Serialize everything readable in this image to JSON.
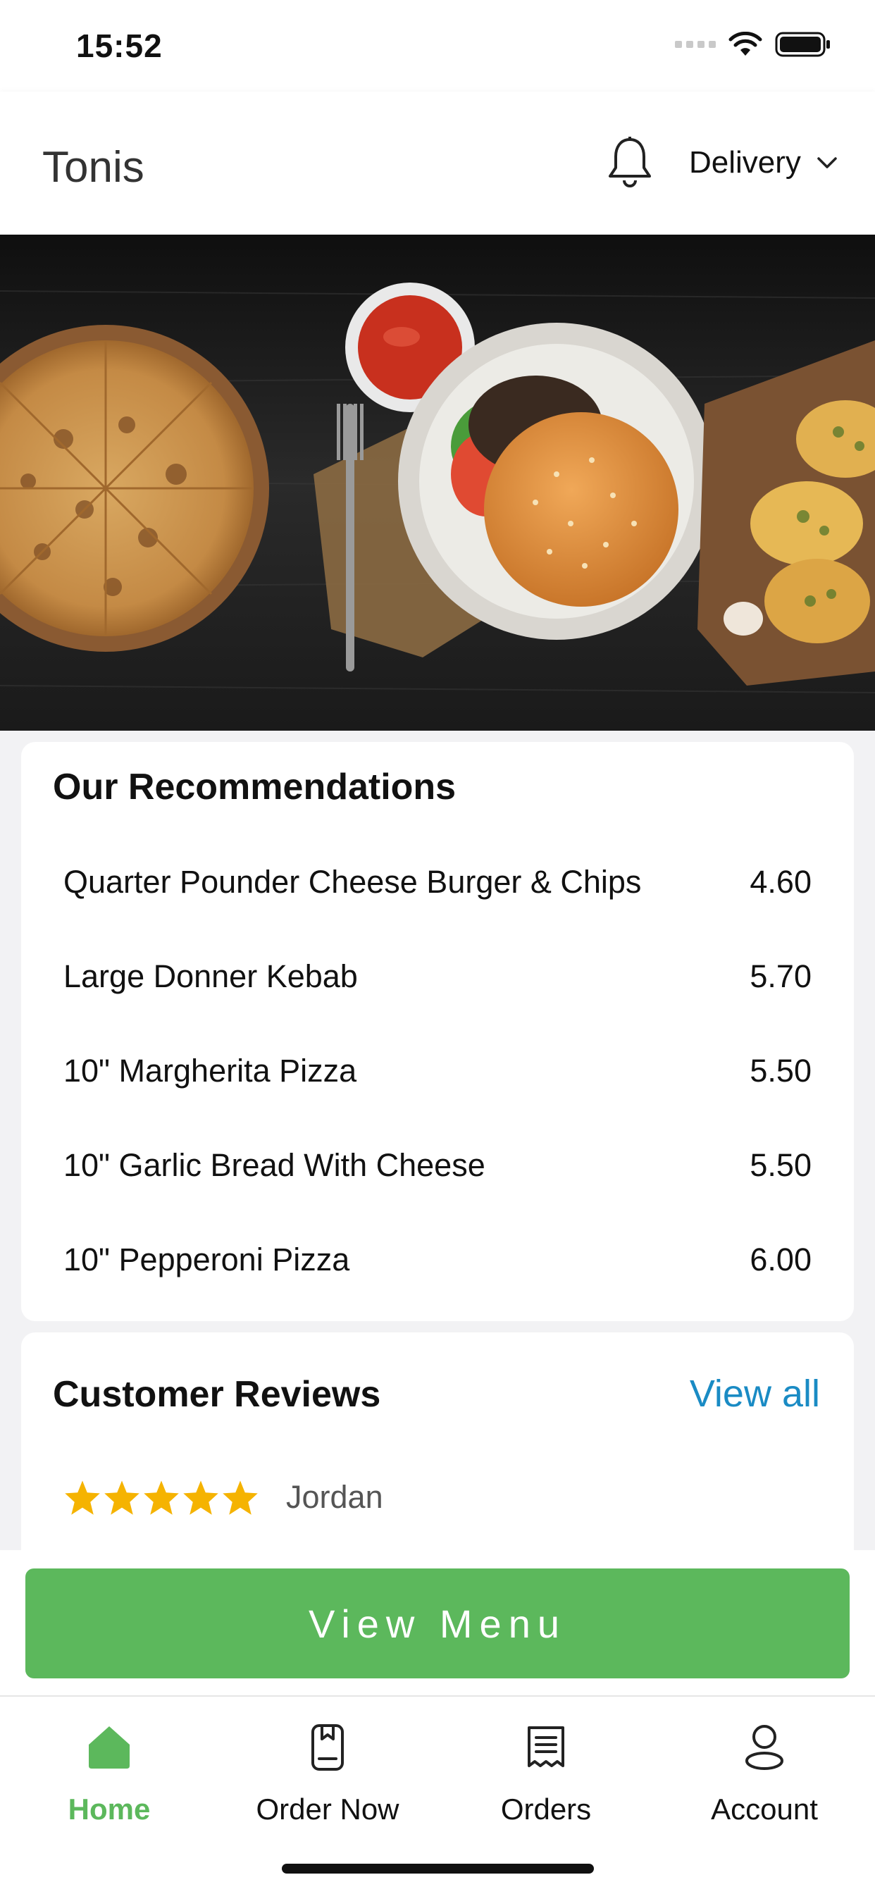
{
  "status_bar": {
    "time": "15:52"
  },
  "header": {
    "title": "Tonis",
    "bell_icon": "bell-icon",
    "delivery_label": "Delivery",
    "chevron_icon": "chevron-down-icon"
  },
  "hero": {
    "description_icon": "food-banner-image"
  },
  "recommendations": {
    "title": "Our Recommendations",
    "items": [
      {
        "name": "Quarter Pounder Cheese Burger & Chips",
        "price": "4.60"
      },
      {
        "name": "Large Donner Kebab",
        "price": "5.70"
      },
      {
        "name": "10\" Margherita Pizza",
        "price": "5.50"
      },
      {
        "name": "10\" Garlic Bread With Cheese",
        "price": "5.50"
      },
      {
        "name": "10\" Pepperoni Pizza",
        "price": "6.00"
      }
    ]
  },
  "reviews": {
    "title": "Customer Reviews",
    "view_all": "View all",
    "items": [
      {
        "reviewer": "Jordan",
        "stars": 5
      }
    ]
  },
  "cta": {
    "label": "View Menu"
  },
  "tabs": [
    {
      "label": "Home",
      "icon": "home-icon",
      "active": true
    },
    {
      "label": "Order Now",
      "icon": "order-icon",
      "active": false
    },
    {
      "label": "Orders",
      "icon": "receipt-icon",
      "active": false
    },
    {
      "label": "Account",
      "icon": "user-icon",
      "active": false
    }
  ],
  "colors": {
    "accent_green": "#5cb85c",
    "link_blue": "#1a8bc4",
    "star_yellow": "#f5b301"
  }
}
